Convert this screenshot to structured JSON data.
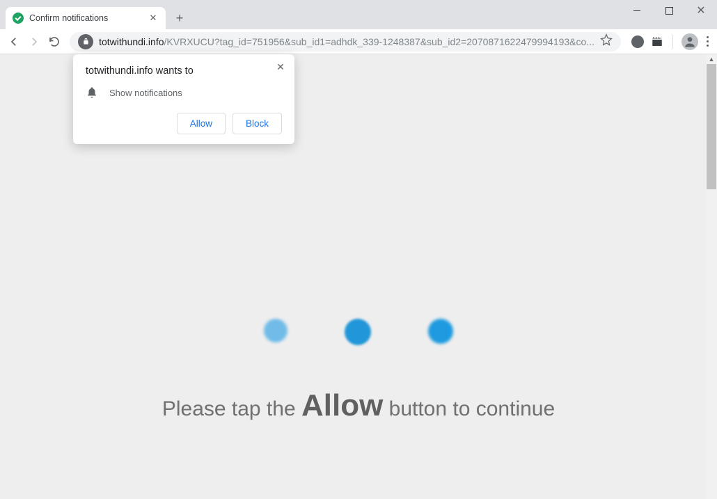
{
  "tab": {
    "title": "Confirm notifications"
  },
  "url": {
    "host": "totwithundi.info",
    "path": "/KVRXUCU?tag_id=751956&sub_id1=adhdk_339-1248387&sub_id2=2070871622479994193&co..."
  },
  "permission": {
    "title": "totwithundi.info wants to",
    "request": "Show notifications",
    "allow": "Allow",
    "block": "Block"
  },
  "page": {
    "msg_before": "Please tap the ",
    "msg_allow": "Allow",
    "msg_after": " button to continue"
  }
}
